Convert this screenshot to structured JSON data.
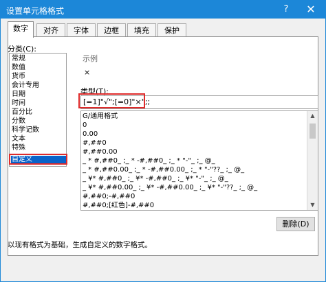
{
  "window": {
    "title": "设置单元格格式",
    "help_label": "?",
    "close_label": "✕"
  },
  "tabs": [
    "数字",
    "对齐",
    "字体",
    "边框",
    "填充",
    "保护"
  ],
  "category": {
    "label": "分类(C):",
    "items": [
      "常规",
      "数值",
      "货币",
      "会计专用",
      "日期",
      "时间",
      "百分比",
      "分数",
      "科学记数",
      "文本",
      "特殊",
      "自定义"
    ],
    "selected": "自定义"
  },
  "sample": {
    "label": "示例",
    "value": "×"
  },
  "type": {
    "label": "类型(T):",
    "value": "[=1]\"√\";[=0]\"×\";;"
  },
  "formats": [
    "G/通用格式",
    "0",
    "0.00",
    "#,##0",
    "#,##0.00",
    "_ * #,##0_ ;_ * -#,##0_ ;_ * \"-\"_ ;_ @_",
    "_ * #,##0.00_ ;_ * -#,##0.00_ ;_ * \"-\"??_ ;_ @_",
    "_ ¥* #,##0_ ;_ ¥* -#,##0_ ;_ ¥* \"-\"_ ;_ @_",
    "_ ¥* #,##0.00_ ;_ ¥* -#,##0.00_ ;_ ¥* \"-\"??_ ;_ @_",
    "#,##0;-#,##0",
    "#,##0;[红色]-#,##0"
  ],
  "delete_label": "删除(D)",
  "description": "以现有格式为基础，生成自定义的数字格式。",
  "colors": {
    "titlebar": "#1c87d8",
    "selection": "#0a63c9",
    "highlight": "#df2b2b"
  }
}
